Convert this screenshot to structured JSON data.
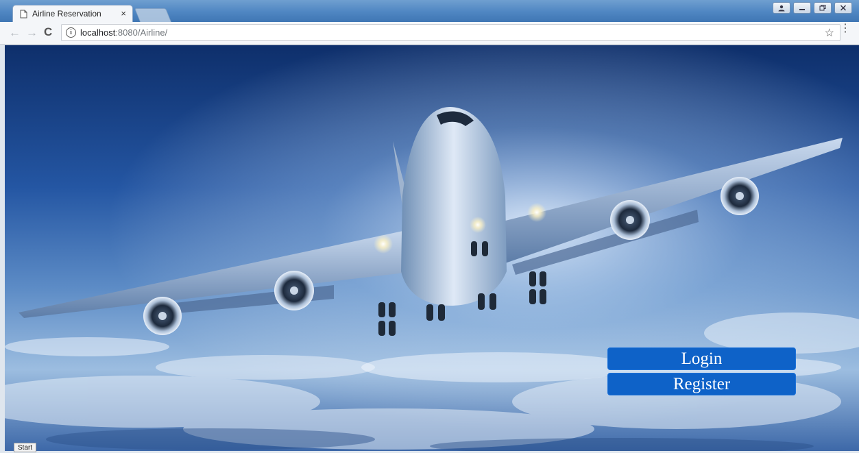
{
  "browser": {
    "tab_title": "Airline Reservation",
    "tab_close": "×",
    "url_host": "localhost",
    "url_rest": ":8080/Airline/",
    "star": "☆",
    "menu": "⋮",
    "back": "←",
    "forward": "→",
    "reload": "C",
    "info": "i"
  },
  "page": {
    "login_label": "Login",
    "register_label": "Register",
    "button_color": "#0e62c8"
  },
  "taskbar": {
    "start_label": "Start"
  }
}
